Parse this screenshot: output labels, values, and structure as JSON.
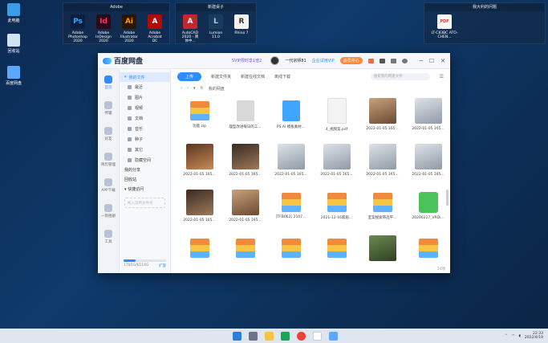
{
  "desktop": {
    "icons": [
      {
        "label": "此电脑",
        "color": "#3a9be8"
      },
      {
        "label": "回收站",
        "color": "#cfe3f2"
      },
      {
        "label": "百度网盘",
        "color": "#5aa8ff"
      }
    ],
    "fences": [
      {
        "title": "Adobe",
        "apps": [
          {
            "short": "Ps",
            "label": "Adobe Photoshop 2020",
            "bg": "#0c1f3f",
            "fg": "#31a8ff"
          },
          {
            "short": "Id",
            "label": "Adobe InDesign 2020",
            "bg": "#2b0a18",
            "fg": "#ff3366"
          },
          {
            "short": "Ai",
            "label": "Adobe Illustrator 2020",
            "bg": "#2b1700",
            "fg": "#ff9a00"
          },
          {
            "short": "A",
            "label": "Adobe Acrobat DC",
            "bg": "#b30b00",
            "fg": "#ffffff"
          }
        ]
      },
      {
        "title": "新建桌子",
        "apps": [
          {
            "short": "A",
            "label": "AutoCAD 2020 - 简体中...",
            "bg": "#c4262e",
            "fg": "#ffffff"
          },
          {
            "short": "L",
            "label": "Lumion 11.0",
            "bg": "#1b3b5c",
            "fg": "#9fd1ff"
          },
          {
            "short": "R",
            "label": "Rhino 7",
            "bg": "#f2f2f2",
            "fg": "#333333"
          }
        ]
      },
      {
        "title": "我大利的问题",
        "apps": [
          {
            "short": "PDF",
            "label": "LT-C83BC ATO-CHEN...",
            "bg": "#f7f7f7",
            "fg": "#d9342b"
          }
        ]
      }
    ]
  },
  "window": {
    "logo": "百度网盘",
    "promo": "SVIP限时享1倍2",
    "username": "一代宗师81",
    "vip_label": "企业试用VIP",
    "member_button": "会员中心",
    "rail": [
      {
        "label": "首页",
        "active": true
      },
      {
        "label": "传输",
        "active": false
      },
      {
        "label": "好友",
        "active": false
      },
      {
        "label": "简历管理",
        "active": false
      },
      {
        "label": "APP下载",
        "active": false
      },
      {
        "label": "一刻相册",
        "active": false
      },
      {
        "label": "工具",
        "active": false
      }
    ],
    "sidebar": {
      "my_files": "我的文件",
      "items": [
        "最近",
        "图片",
        "视频",
        "文档",
        "音乐",
        "种子",
        "其它",
        "隐藏空间"
      ],
      "share": "我的分享",
      "recycle": "回收站",
      "quick": "快捷访问",
      "quick_box": "拖入常用文件夹",
      "storage_used": "1785G/6114G",
      "storage_expand": "扩容",
      "storage_fill": 0.29
    },
    "toolbar": {
      "upload": "上传",
      "new_folder": "新建文件夹",
      "new_online": "新建在线文档",
      "offline": "离线下载",
      "search_placeholder": "搜索我的网盘文件"
    },
    "crumb": "我的网盘",
    "files": [
      {
        "name": "功能.zip",
        "kind": "t-zip"
      },
      {
        "name": "理型改进每日的工...",
        "kind": "t-doc"
      },
      {
        "name": "PS.AI 模板素材...",
        "kind": "t-ai"
      },
      {
        "name": "4_视频案.pdf",
        "kind": "t-pdf"
      },
      {
        "name": "2022-01-05 165...",
        "kind": "t-photo1"
      },
      {
        "name": "2022-01-05 165...",
        "kind": "t-photo2"
      },
      {
        "name": "2022-01-05 165...",
        "kind": "t-photo3"
      },
      {
        "name": "2022-01-05 165...",
        "kind": "t-photo4"
      },
      {
        "name": "2022-01-05 165...",
        "kind": "t-photo2"
      },
      {
        "name": "2022-01-05 165...",
        "kind": "t-photo2"
      },
      {
        "name": "2022-01-05 165...",
        "kind": "t-photo2"
      },
      {
        "name": "2022-01-05 165...",
        "kind": "t-photo2"
      },
      {
        "name": "2022-01-05 165...",
        "kind": "t-photo4"
      },
      {
        "name": "2022-01-05 165...",
        "kind": "t-photo1"
      },
      {
        "name": "[TFB063] 2107...",
        "kind": "t-zip"
      },
      {
        "name": "2021-12-16家居...",
        "kind": "t-zip"
      },
      {
        "name": "室案搜索筛选平...",
        "kind": "t-zip"
      },
      {
        "name": "20200227_VRDi...",
        "kind": "t-green"
      },
      {
        "name": "",
        "kind": "t-zip"
      },
      {
        "name": "",
        "kind": "t-zip"
      },
      {
        "name": "",
        "kind": "t-zip"
      },
      {
        "name": "",
        "kind": "t-zip"
      },
      {
        "name": "",
        "kind": "t-photo5"
      },
      {
        "name": "",
        "kind": "t-zip"
      }
    ],
    "count": "24项"
  },
  "taskbar": {
    "time": "22:33",
    "date": "2022/4/19"
  }
}
